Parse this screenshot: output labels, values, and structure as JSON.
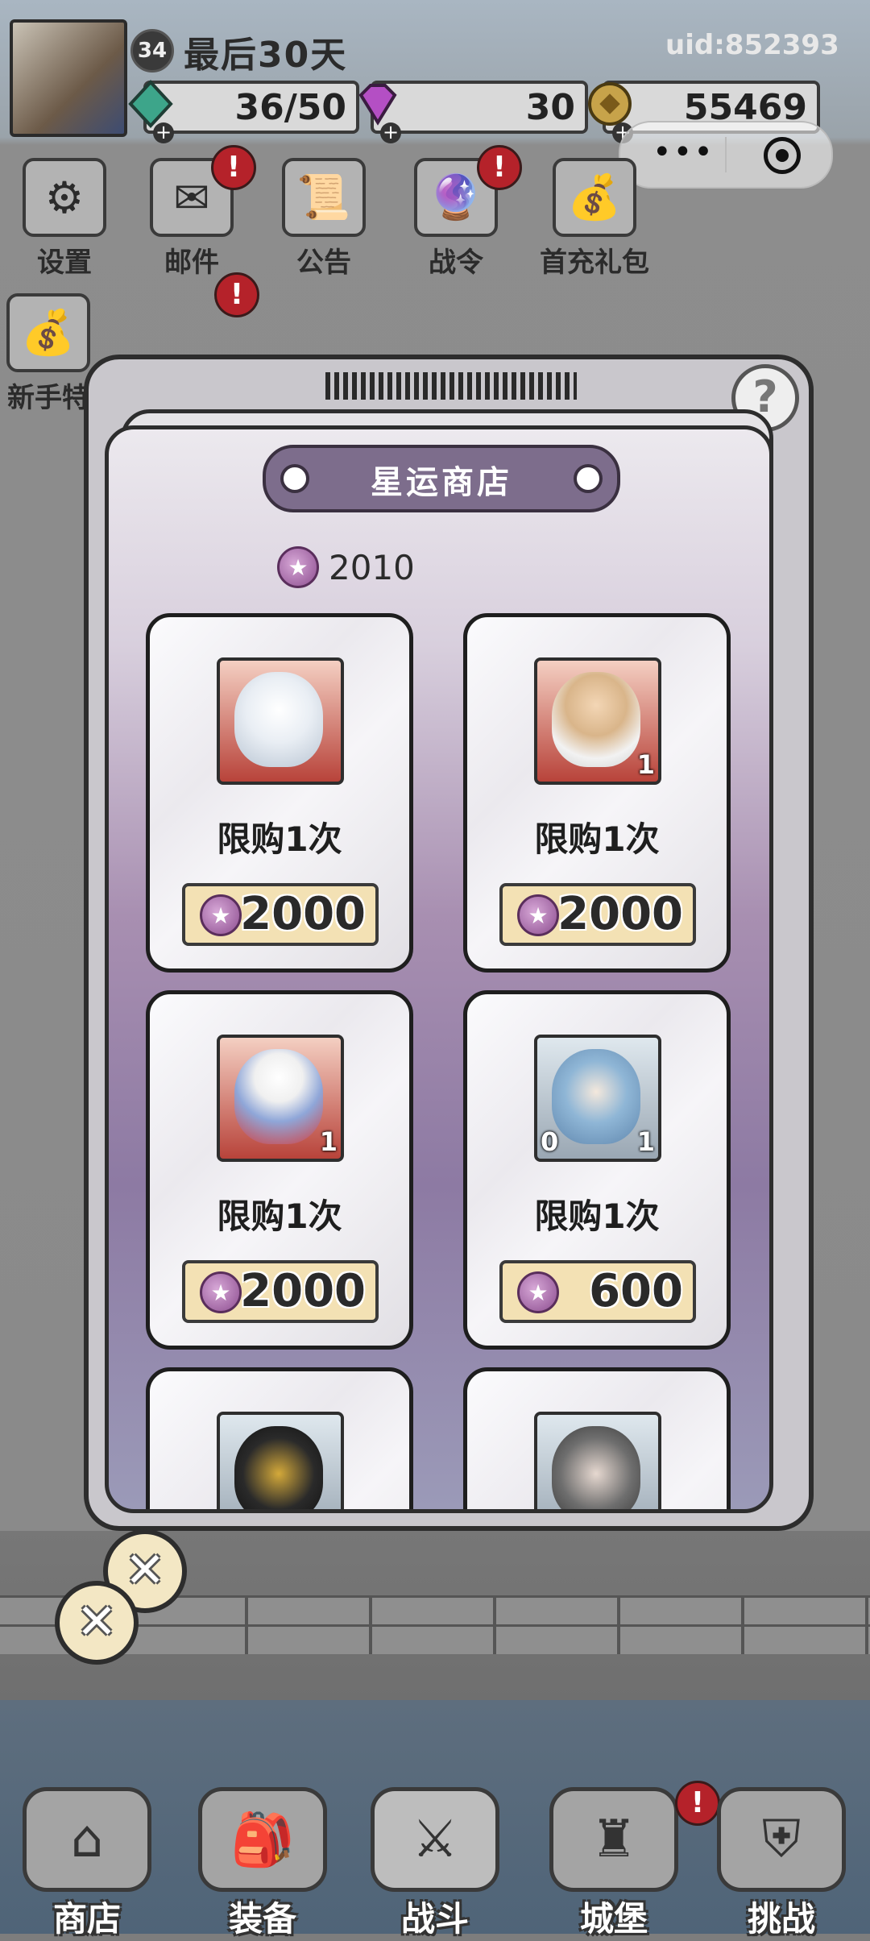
{
  "player": {
    "level": "34",
    "name": "最后30天",
    "uid": "uid:852393"
  },
  "resources": {
    "energy": "36/50",
    "gems": "30",
    "gold": "55469"
  },
  "top_menu": [
    {
      "label": "设置",
      "icon": "gear-icon",
      "alert": false
    },
    {
      "label": "邮件",
      "icon": "mail-icon",
      "alert": true
    },
    {
      "label": "公告",
      "icon": "scroll-icon",
      "alert": false
    },
    {
      "label": "战令",
      "icon": "crystal-ball-icon",
      "alert": true
    },
    {
      "label": "首充礼包",
      "icon": "gift-bag-icon",
      "alert": false
    }
  ],
  "second_menu": [
    {
      "label": "新手特",
      "icon": "newbie-bag-icon",
      "alert": false
    }
  ],
  "shop": {
    "title": "星运商店",
    "currency_amount": "2010",
    "items": [
      {
        "limit": "限购1次",
        "price": "2000",
        "frame": "red",
        "count": "",
        "level": ""
      },
      {
        "limit": "限购1次",
        "price": "2000",
        "frame": "red",
        "count": "1",
        "level": ""
      },
      {
        "limit": "限购1次",
        "price": "2000",
        "frame": "red",
        "count": "1",
        "level": ""
      },
      {
        "limit": "限购1次",
        "price": "600",
        "frame": "grey",
        "count": "1",
        "level": "0"
      }
    ],
    "help_label": "?"
  },
  "close_labels": [
    "✕",
    "✕"
  ],
  "bottom_nav": [
    {
      "label": "商店",
      "icon": "shop-house-icon"
    },
    {
      "label": "装备",
      "icon": "backpack-icon"
    },
    {
      "label": "战斗",
      "icon": "crossed-swords-icon"
    },
    {
      "label": "城堡",
      "icon": "castle-icon"
    },
    {
      "label": "挑战",
      "icon": "shield-icon"
    }
  ],
  "colors": {
    "panel_purple": "#7d6d8c",
    "price_bg": "#f3e1b4",
    "alert_red": "#b5222a"
  }
}
